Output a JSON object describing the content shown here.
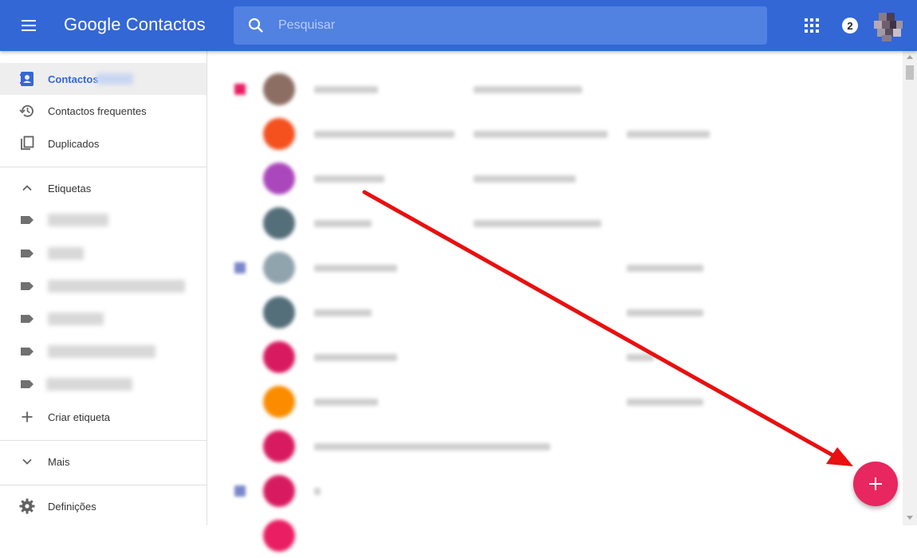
{
  "header": {
    "app_title": "Google Contactos",
    "search_placeholder": "Pesquisar",
    "notification_count": "2",
    "colors": {
      "bar": "#3367d6",
      "search_bg": "#5181e1"
    }
  },
  "sidebar": {
    "items": [
      {
        "label": "Contactos",
        "icon": "contacts-icon",
        "active": true
      },
      {
        "label": "Contactos frequentes",
        "icon": "history-icon"
      },
      {
        "label": "Duplicados",
        "icon": "duplicate-icon"
      }
    ],
    "labels_section": {
      "title": "Etiquetas",
      "icon": "chevron-up-icon",
      "label_count": 6,
      "create_label": "Criar etiqueta",
      "create_icon": "plus-icon"
    },
    "more": {
      "label": "Mais",
      "icon": "chevron-down-icon"
    },
    "settings": {
      "label": "Definições",
      "icon": "gear-icon"
    }
  },
  "contacts": {
    "rows": [
      {
        "avatar_color": "#8d6e63",
        "marker_color": "#e91e63"
      },
      {
        "avatar_color": "#f4511e"
      },
      {
        "avatar_color": "#ab47bc"
      },
      {
        "avatar_color": "#546e7a"
      },
      {
        "avatar_color": "#90a4ae",
        "marker_color": "#7986cb"
      },
      {
        "avatar_color": "#546e7a"
      },
      {
        "avatar_color": "#d81b60"
      },
      {
        "avatar_color": "#fb8c00"
      },
      {
        "avatar_color": "#d81b60"
      },
      {
        "avatar_color": "#d81b60",
        "marker_color": "#7986cb"
      }
    ]
  },
  "fab": {
    "icon": "plus-icon",
    "color": "#e8265f"
  },
  "annotation": {
    "arrow_color": "#e81010"
  }
}
